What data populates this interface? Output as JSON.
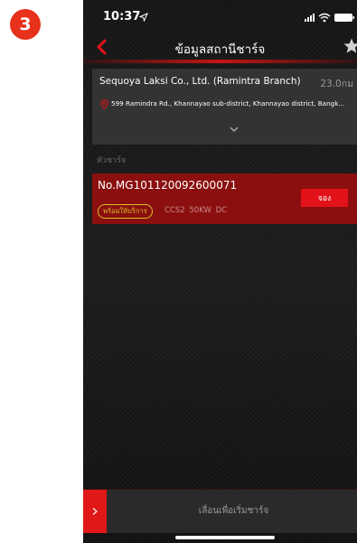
{
  "step": {
    "number": "3"
  },
  "status_bar": {
    "time": "10:37"
  },
  "nav": {
    "title": "ข้อมูลสถานีชาร์จ"
  },
  "station": {
    "name": "Sequoya Laksi Co., Ltd. (Ramintra Branch)",
    "distance": "23.0กม",
    "address": "599 Ramindra Rd., Khannayao sub-district, Khannayao district, Bangk..."
  },
  "section": {
    "label": "หัวชาร์จ"
  },
  "charger": {
    "id": "No.MG101120092600071",
    "status": "พร้อมให้บริการ",
    "spec": "CCS2  50KW  DC",
    "book_label": "จอง"
  },
  "slider": {
    "label": "เลื่อนเพื่อเริ่มชาร์จ"
  },
  "colors": {
    "accent": "#e3121a",
    "charger_card": "#8b0f0f",
    "status_badge": "#d6c12a",
    "step_badge": "#e8311a"
  },
  "icons": [
    "back-arrow-icon",
    "star-icon",
    "location-pin-icon",
    "chevron-down-icon",
    "chevron-right-icon",
    "signal-icon",
    "wifi-icon",
    "battery-icon",
    "location-arrow-icon"
  ]
}
